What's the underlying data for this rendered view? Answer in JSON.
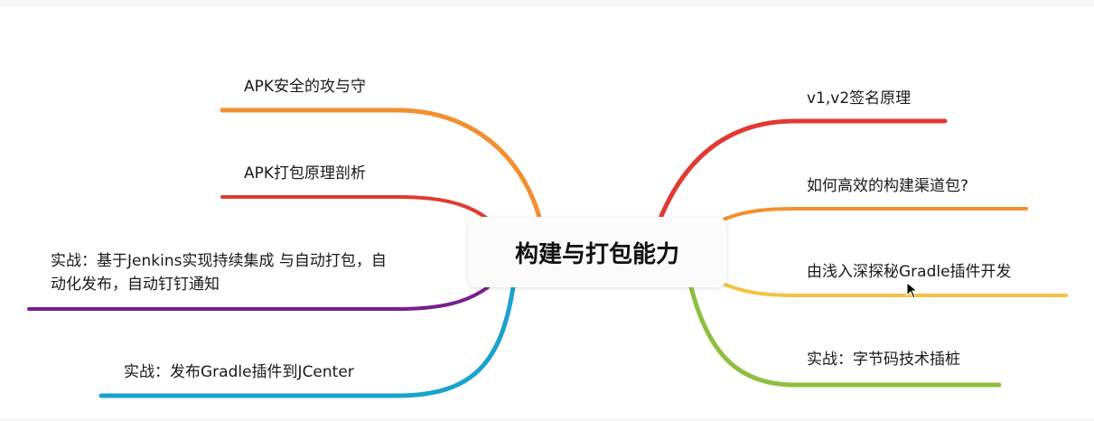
{
  "center": {
    "label": "构建与打包能力"
  },
  "left_branches": [
    {
      "label": "APK安全的攻与守",
      "color": "#f2902f"
    },
    {
      "label": "APK打包原理剖析",
      "color": "#e03a32"
    },
    {
      "label": "实战：基于Jenkins实现持续集成 与自动打包，自动化发布，自动钉钉通知",
      "color": "#7a1f8c"
    },
    {
      "label": "实战：发布Gradle插件到JCenter",
      "color": "#1aa3cc"
    }
  ],
  "right_branches": [
    {
      "label": "v1,v2签名原理",
      "color": "#e03a32"
    },
    {
      "label": "如何高效的构建渠道包?",
      "color": "#f2902f"
    },
    {
      "label": "由浅入深探秘Gradle插件开发",
      "color": "#f5c242"
    },
    {
      "label": "实战：字节码技术插桩",
      "color": "#8fbf3f"
    }
  ]
}
